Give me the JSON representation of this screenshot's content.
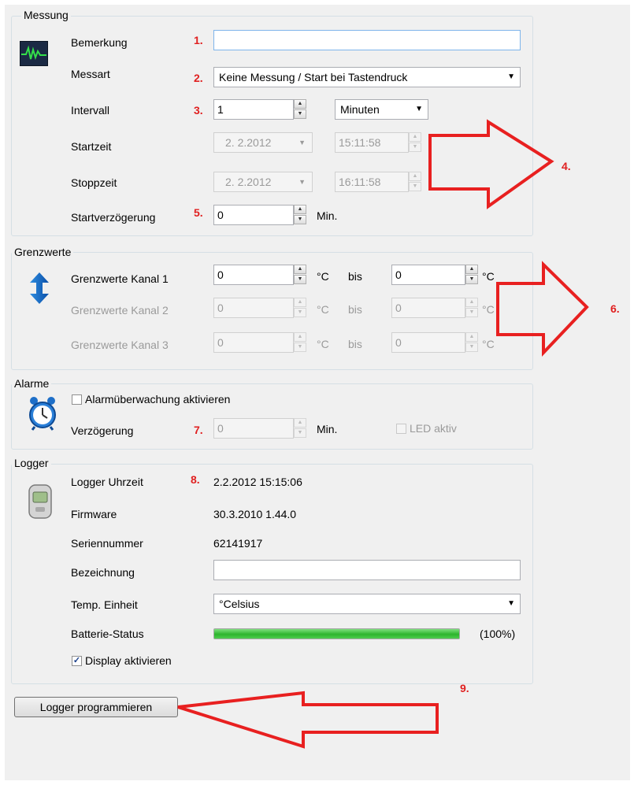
{
  "messung": {
    "title": "Messung",
    "bemerkung_label": "Bemerkung",
    "bemerkung_value": "",
    "messart_label": "Messart",
    "messart_value": "Keine Messung / Start bei Tastendruck",
    "intervall_label": "Intervall",
    "intervall_value": "1",
    "intervall_unit": "Minuten",
    "startzeit_label": "Startzeit",
    "startzeit_date": "2.  2.2012",
    "startzeit_time": "15:11:58",
    "stoppzeit_label": "Stoppzeit",
    "stoppzeit_date": "2.  2.2012",
    "stoppzeit_time": "16:11:58",
    "startverz_label": "Startverzögerung",
    "startverz_value": "0",
    "startverz_unit": "Min."
  },
  "grenzwerte": {
    "title": "Grenzwerte",
    "unit": "°C",
    "bis": "bis",
    "rows": [
      {
        "label": "Grenzwerte Kanal 1",
        "from": "0",
        "to": "0"
      },
      {
        "label": "Grenzwerte Kanal 2",
        "from": "0",
        "to": "0"
      },
      {
        "label": "Grenzwerte Kanal 3",
        "from": "0",
        "to": "0"
      }
    ]
  },
  "alarme": {
    "title": "Alarme",
    "aktivieren_label": "Alarmüberwachung aktivieren",
    "verz_label": "Verzögerung",
    "verz_value": "0",
    "verz_unit": "Min.",
    "led_label": "LED aktiv"
  },
  "logger": {
    "title": "Logger",
    "uhrzeit_label": "Logger Uhrzeit",
    "uhrzeit_value": "2.2.2012 15:15:06",
    "firmware_label": "Firmware",
    "firmware_value": "30.3.2010  1.44.0",
    "serien_label": "Seriennummer",
    "serien_value": "62141917",
    "bezeichnung_label": "Bezeichnung",
    "bezeichnung_value": "",
    "temp_label": "Temp. Einheit",
    "temp_value": "°Celsius",
    "batterie_label": "Batterie-Status",
    "batterie_percent": 100,
    "batterie_text": "(100%)",
    "display_label": "Display aktivieren",
    "display_checked": true
  },
  "program_button": "Logger programmieren",
  "annotations": [
    "1.",
    "2.",
    "3.",
    "4.",
    "5.",
    "6.",
    "7.",
    "8.",
    "9."
  ],
  "colors": {
    "annotation": "#e02020",
    "battery": "#3cc43c",
    "window": "#f0f0f0"
  }
}
